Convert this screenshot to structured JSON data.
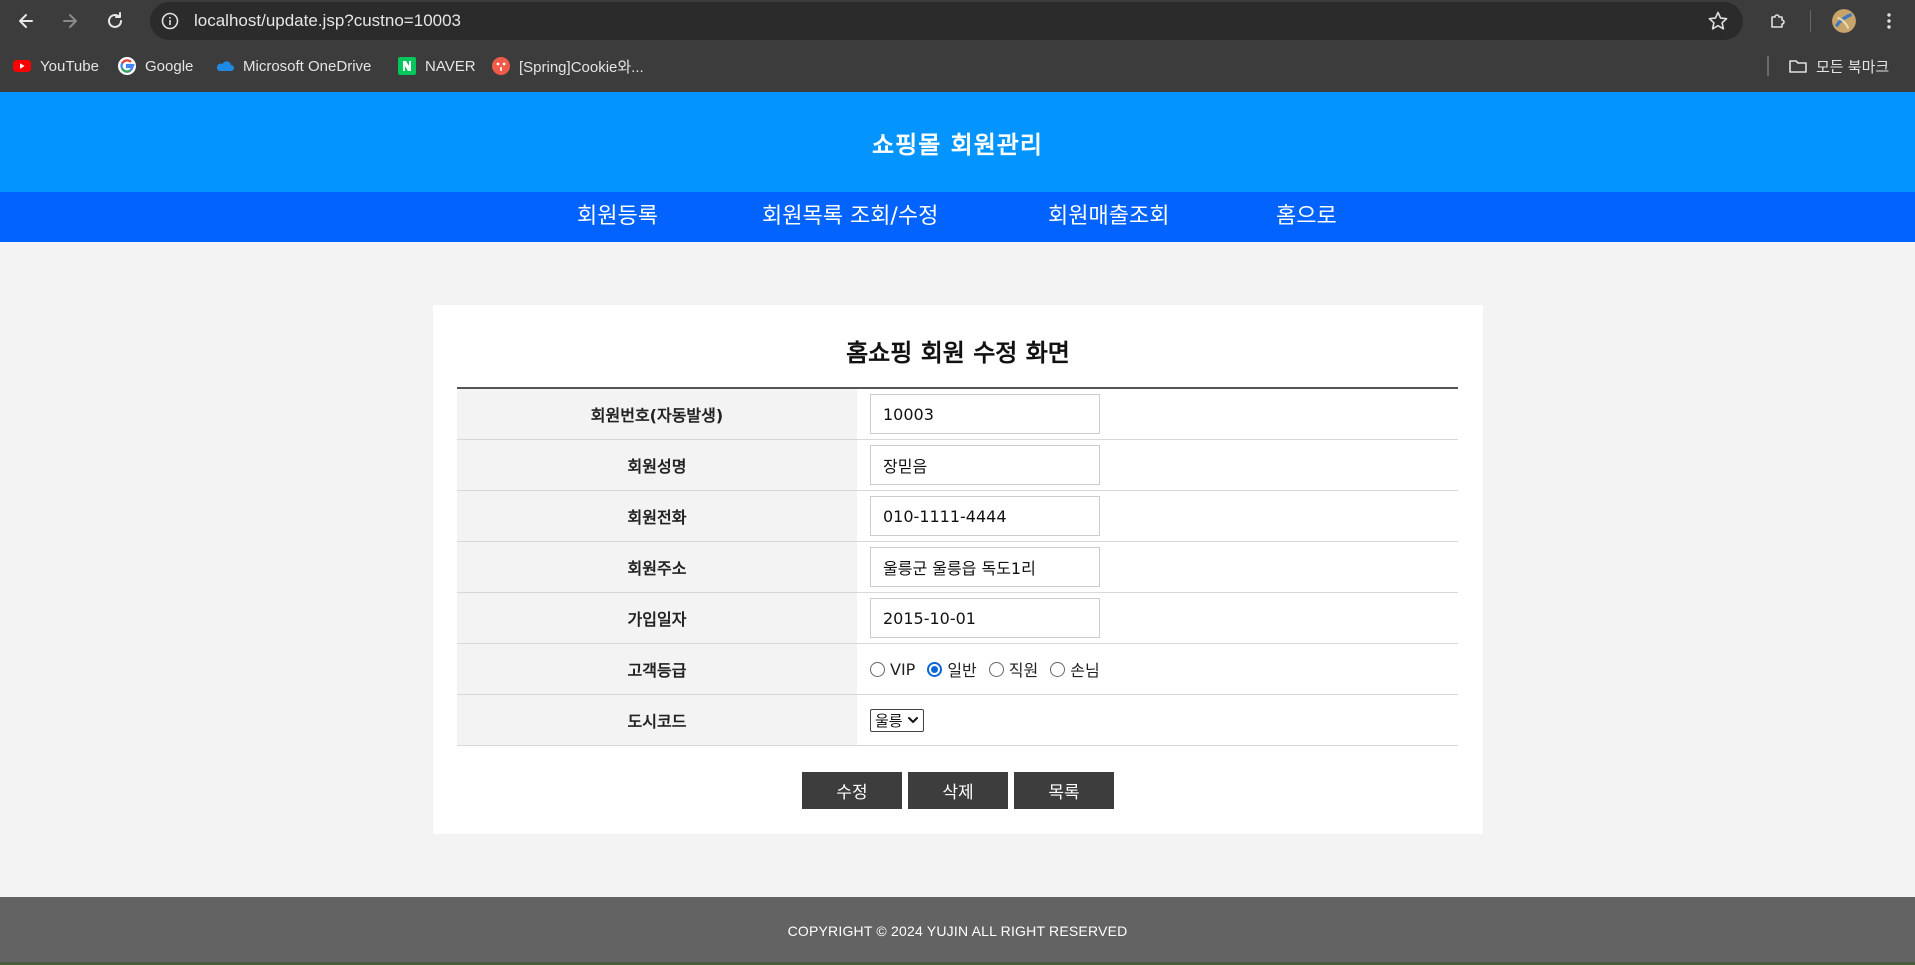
{
  "browser": {
    "url": "localhost/update.jsp?custno=10003",
    "bookmarks": [
      {
        "label": "YouTube",
        "icon": "youtube-icon"
      },
      {
        "label": "Google",
        "icon": "google-icon"
      },
      {
        "label": "Microsoft OneDrive",
        "icon": "onedrive-icon"
      },
      {
        "label": "NAVER",
        "icon": "naver-icon"
      },
      {
        "label": "[Spring]Cookie와...",
        "icon": "site-icon"
      }
    ],
    "all_bookmarks_label": "모든 북마크"
  },
  "header": {
    "title": "쇼핑몰 회원관리"
  },
  "nav": {
    "items": [
      {
        "label": "회원등록"
      },
      {
        "label": "회원목록 조회/수정"
      },
      {
        "label": "회원매출조회"
      },
      {
        "label": "홈으로"
      }
    ]
  },
  "form": {
    "title": "홈쇼핑 회원 수정 화면",
    "fields": {
      "custno": {
        "label": "회원번호(자동발생)",
        "value": "10003"
      },
      "custname": {
        "label": "회원성명",
        "value": "장믿음"
      },
      "phone": {
        "label": "회원전화",
        "value": "010-1111-4444"
      },
      "address": {
        "label": "회원주소",
        "value": "울릉군 울릉읍 독도1리"
      },
      "joindate": {
        "label": "가입일자",
        "value": "2015-10-01"
      },
      "grade": {
        "label": "고객등급",
        "options": [
          "VIP",
          "일반",
          "직원",
          "손님"
        ],
        "selected": "일반"
      },
      "city": {
        "label": "도시코드",
        "value": "울릉"
      }
    },
    "buttons": {
      "update": "수정",
      "delete": "삭제",
      "list": "목록"
    }
  },
  "footer": {
    "text": "COPYRIGHT © 2024 YUJIN ALL RIGHT RESERVED"
  },
  "colors": {
    "header_bg": "#0395fd",
    "nav_bg": "#0263ff",
    "button_bg": "#3d3d3d",
    "footer_bg": "#636363"
  }
}
